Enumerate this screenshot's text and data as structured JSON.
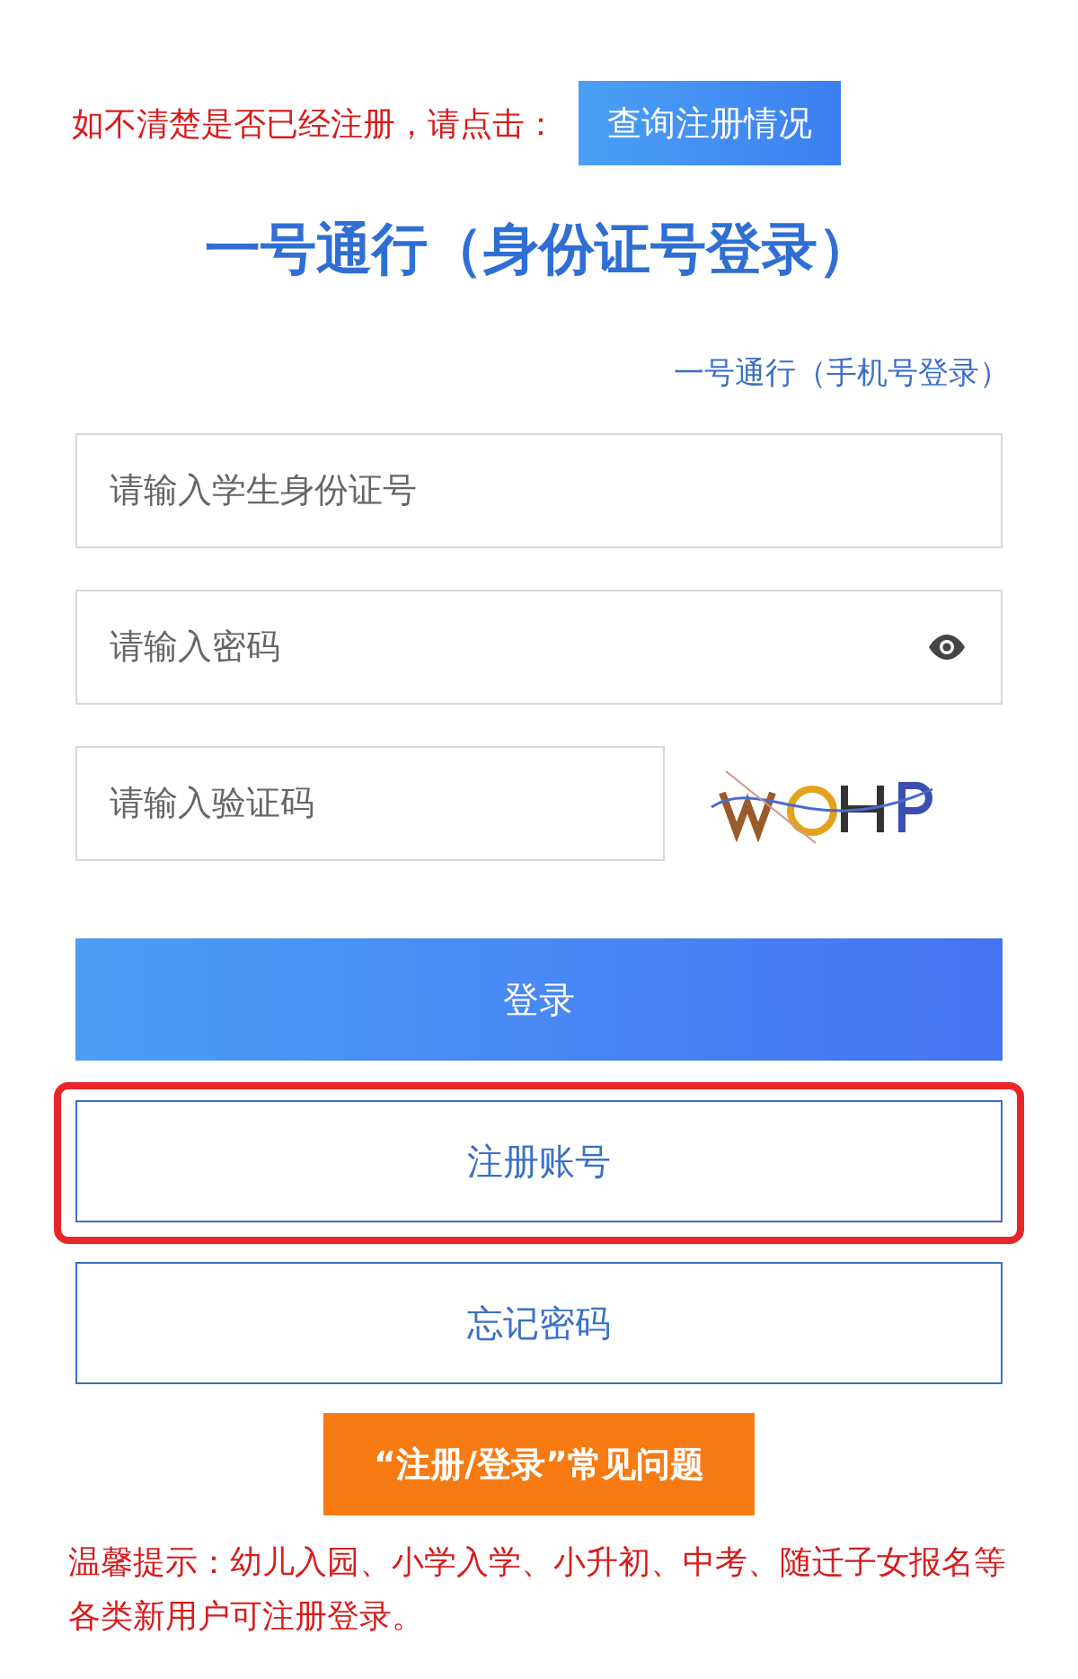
{
  "notice": {
    "text": "如不清楚是否已经注册，请点击：",
    "button": "查询注册情况"
  },
  "title": "一号通行（身份证号登录）",
  "alt_login_link": "一号通行（手机号登录）",
  "fields": [
    {
      "kind": "text",
      "placeholder": "请输入学生身份证号"
    },
    {
      "kind": "password",
      "placeholder": "请输入密码"
    },
    {
      "kind": "captcha",
      "placeholder": "请输入验证码"
    }
  ],
  "buttons": [
    {
      "kind": "primary",
      "label": "登录",
      "highlighted": false
    },
    {
      "kind": "outline",
      "label": "注册账号",
      "highlighted": true
    },
    {
      "kind": "outline",
      "label": "忘记密码",
      "highlighted": false
    }
  ],
  "faq_button": "“注册/登录”常见问题",
  "tip": "温馨提示：幼儿入园、小学入学、小升初、中考、随迁子女报名等各类新用户可注册登录。"
}
